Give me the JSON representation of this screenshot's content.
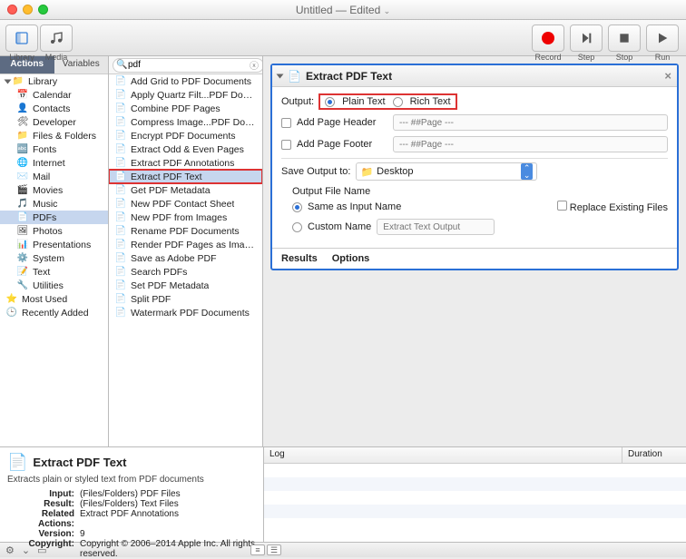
{
  "window": {
    "title": "Untitled",
    "edited": "Edited"
  },
  "toolbar": {
    "library": "Library",
    "media": "Media",
    "record": "Record",
    "step": "Step",
    "stop": "Stop",
    "run": "Run"
  },
  "tabs": {
    "actions": "Actions",
    "variables": "Variables"
  },
  "search": {
    "value": "pdf"
  },
  "library": {
    "root": "Library",
    "items": [
      "Calendar",
      "Contacts",
      "Developer",
      "Files & Folders",
      "Fonts",
      "Internet",
      "Mail",
      "Movies",
      "Music",
      "PDFs",
      "Photos",
      "Presentations",
      "System",
      "Text",
      "Utilities"
    ],
    "selected": "PDFs",
    "extras": [
      "Most Used",
      "Recently Added"
    ]
  },
  "actions": [
    "Add Grid to PDF Documents",
    "Apply Quartz Filt...PDF Documents",
    "Combine PDF Pages",
    "Compress Image...PDF Documents",
    "Encrypt PDF Documents",
    "Extract Odd & Even Pages",
    "Extract PDF Annotations",
    "Extract PDF Text",
    "Get PDF Metadata",
    "New PDF Contact Sheet",
    "New PDF from Images",
    "Rename PDF Documents",
    "Render PDF Pages as Images",
    "Save as Adobe PDF",
    "Search PDFs",
    "Set PDF Metadata",
    "Split PDF",
    "Watermark PDF Documents"
  ],
  "actions_selected": "Extract PDF Text",
  "card": {
    "title": "Extract PDF Text",
    "output_label": "Output:",
    "plain": "Plain Text",
    "rich": "Rich Text",
    "add_header": "Add Page Header",
    "add_footer": "Add Page Footer",
    "page_ph": "--- ##Page ---",
    "save_label": "Save Output to:",
    "save_dest": "Desktop",
    "filename_label": "Output File Name",
    "same_name": "Same as Input Name",
    "custom_name": "Custom Name",
    "custom_ph": "Extract Text Output",
    "replace": "Replace Existing Files",
    "results": "Results",
    "options": "Options"
  },
  "info": {
    "title": "Extract PDF Text",
    "desc": "Extracts plain or styled text from PDF documents",
    "input_k": "Input:",
    "input_v": "(Files/Folders) PDF Files",
    "result_k": "Result:",
    "result_v": "(Files/Folders) Text Files",
    "related_k": "Related Actions:",
    "related_v": "Extract PDF Annotations",
    "version_k": "Version:",
    "version_v": "9",
    "copyright_k": "Copyright:",
    "copyright_v": "Copyright © 2006–2014 Apple Inc. All rights reserved."
  },
  "log": {
    "col1": "Log",
    "col2": "Duration"
  }
}
